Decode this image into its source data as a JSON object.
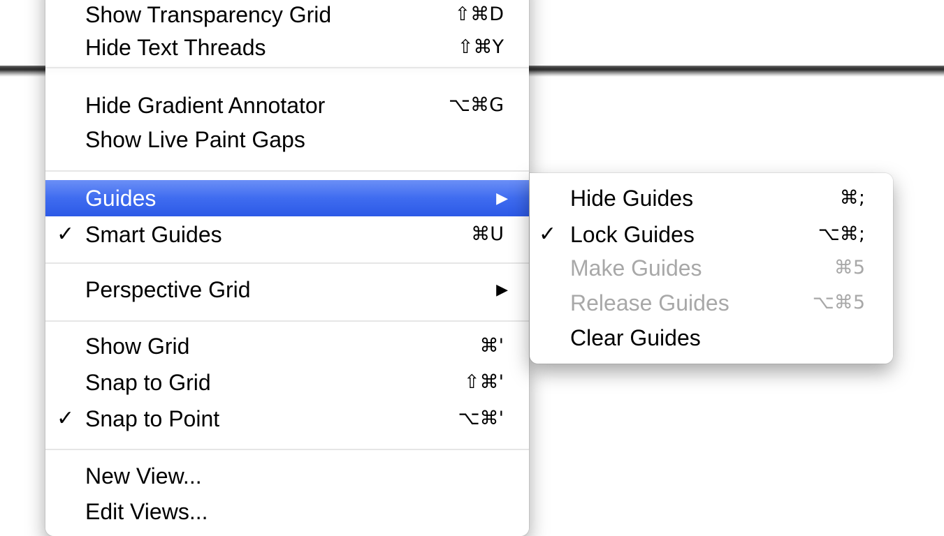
{
  "view_menu": {
    "items": [
      {
        "label": "Show Transparency Grid",
        "shortcut": "⇧⌘D"
      },
      {
        "label": "Hide Text Threads",
        "shortcut": "⇧⌘Y"
      },
      {
        "label": "Hide Gradient Annotator",
        "shortcut": "⌥⌘G"
      },
      {
        "label": "Show Live Paint Gaps",
        "shortcut": ""
      },
      {
        "label": "Guides",
        "submenu_arrow": "▶",
        "highlighted": true
      },
      {
        "label": "Smart Guides",
        "shortcut": "⌘U",
        "check": "✓"
      },
      {
        "label": "Perspective Grid",
        "submenu_arrow": "▶"
      },
      {
        "label": "Show Grid",
        "shortcut": "⌘'"
      },
      {
        "label": "Snap to Grid",
        "shortcut": "⇧⌘'"
      },
      {
        "label": "Snap to Point",
        "shortcut": "⌥⌘'",
        "check": "✓"
      },
      {
        "label": "New View...",
        "shortcut": ""
      },
      {
        "label": "Edit Views...",
        "shortcut": ""
      }
    ]
  },
  "guides_submenu": {
    "items": [
      {
        "label": "Hide Guides",
        "shortcut": "⌘;",
        "enabled": true
      },
      {
        "label": "Lock Guides",
        "shortcut": "⌥⌘;",
        "check": "✓",
        "enabled": true
      },
      {
        "label": "Make Guides",
        "shortcut": "⌘5",
        "enabled": false
      },
      {
        "label": "Release Guides",
        "shortcut": "⌥⌘5",
        "enabled": false
      },
      {
        "label": "Clear Guides",
        "shortcut": "",
        "enabled": true
      }
    ]
  },
  "colors": {
    "highlight": "#3f6cf0",
    "disabled_text": "#a8a8a8"
  }
}
